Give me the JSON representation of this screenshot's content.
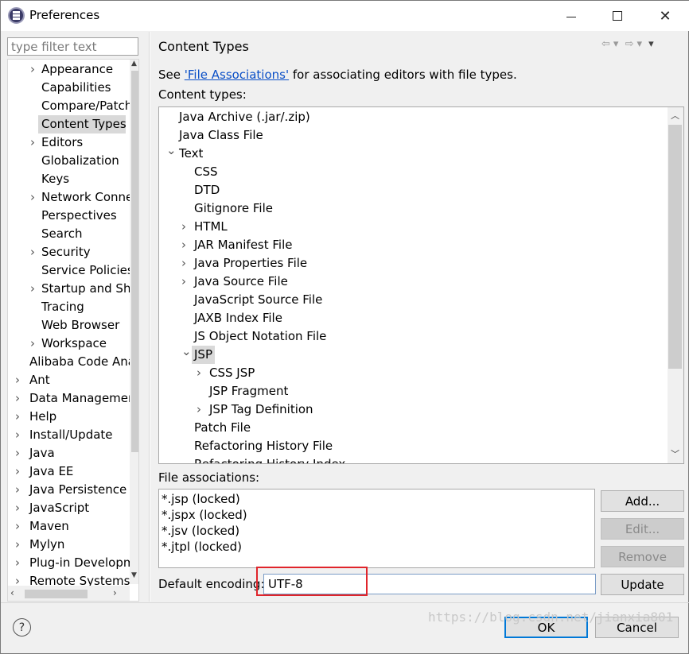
{
  "window": {
    "title": "Preferences",
    "icon": "eclipse-icon"
  },
  "filter": {
    "placeholder": "type filter text"
  },
  "left_tree": [
    {
      "label": "Appearance",
      "expandable": true
    },
    {
      "label": "Capabilities",
      "expandable": false
    },
    {
      "label": "Compare/Patch",
      "expandable": false
    },
    {
      "label": "Content Types",
      "expandable": false,
      "selected": true
    },
    {
      "label": "Editors",
      "expandable": true
    },
    {
      "label": "Globalization",
      "expandable": false
    },
    {
      "label": "Keys",
      "expandable": false
    },
    {
      "label": "Network Connections",
      "expandable": true
    },
    {
      "label": "Perspectives",
      "expandable": false
    },
    {
      "label": "Search",
      "expandable": false
    },
    {
      "label": "Security",
      "expandable": true
    },
    {
      "label": "Service Policies",
      "expandable": false
    },
    {
      "label": "Startup and Shutdown",
      "expandable": true
    },
    {
      "label": "Tracing",
      "expandable": false
    },
    {
      "label": "Web Browser",
      "expandable": false
    },
    {
      "label": "Workspace",
      "expandable": true
    },
    {
      "label": "Alibaba Code Analysis",
      "expandable": false,
      "level": 0
    },
    {
      "label": "Ant",
      "expandable": true,
      "level": 0
    },
    {
      "label": "Data Management",
      "expandable": true,
      "level": 0
    },
    {
      "label": "Help",
      "expandable": true,
      "level": 0
    },
    {
      "label": "Install/Update",
      "expandable": true,
      "level": 0
    },
    {
      "label": "Java",
      "expandable": true,
      "level": 0
    },
    {
      "label": "Java EE",
      "expandable": true,
      "level": 0
    },
    {
      "label": "Java Persistence",
      "expandable": true,
      "level": 0
    },
    {
      "label": "JavaScript",
      "expandable": true,
      "level": 0
    },
    {
      "label": "Maven",
      "expandable": true,
      "level": 0
    },
    {
      "label": "Mylyn",
      "expandable": true,
      "level": 0
    },
    {
      "label": "Plug-in Development",
      "expandable": true,
      "level": 0
    },
    {
      "label": "Remote Systems",
      "expandable": true,
      "level": 0
    }
  ],
  "panel": {
    "title": "Content Types",
    "see_prefix": "See ",
    "see_link": "'File Associations'",
    "see_suffix": " for associating editors with file types.",
    "content_types_label": "Content types:",
    "file_assoc_label": "File associations:",
    "encoding_label": "Default encoding:",
    "encoding_value": "UTF-8"
  },
  "content_tree": [
    {
      "label": "Java Archive (.jar/.zip)",
      "level": 0,
      "toggle": "none"
    },
    {
      "label": "Java Class File",
      "level": 0,
      "toggle": "none"
    },
    {
      "label": "Text",
      "level": 0,
      "toggle": "open"
    },
    {
      "label": "CSS",
      "level": 1,
      "toggle": "none"
    },
    {
      "label": "DTD",
      "level": 1,
      "toggle": "none"
    },
    {
      "label": "Gitignore File",
      "level": 1,
      "toggle": "none"
    },
    {
      "label": "HTML",
      "level": 1,
      "toggle": "closed"
    },
    {
      "label": "JAR Manifest File",
      "level": 1,
      "toggle": "closed"
    },
    {
      "label": "Java Properties File",
      "level": 1,
      "toggle": "closed"
    },
    {
      "label": "Java Source File",
      "level": 1,
      "toggle": "closed"
    },
    {
      "label": "JavaScript Source File",
      "level": 1,
      "toggle": "none"
    },
    {
      "label": "JAXB Index File",
      "level": 1,
      "toggle": "none"
    },
    {
      "label": "JS Object Notation File",
      "level": 1,
      "toggle": "none"
    },
    {
      "label": "JSP",
      "level": 1,
      "toggle": "open",
      "selected": true
    },
    {
      "label": "CSS JSP",
      "level": 2,
      "toggle": "closed"
    },
    {
      "label": "JSP Fragment",
      "level": 2,
      "toggle": "none"
    },
    {
      "label": "JSP Tag Definition",
      "level": 2,
      "toggle": "closed"
    },
    {
      "label": "Patch File",
      "level": 1,
      "toggle": "none"
    },
    {
      "label": "Refactoring History File",
      "level": 1,
      "toggle": "none"
    },
    {
      "label": "Refactoring History Index",
      "level": 1,
      "toggle": "none"
    }
  ],
  "file_associations": [
    "*.jsp (locked)",
    "*.jspx (locked)",
    "*.jsv (locked)",
    "*.jtpl (locked)"
  ],
  "buttons": {
    "add": "Add...",
    "edit": "Edit...",
    "remove": "Remove",
    "update": "Update",
    "ok": "OK",
    "cancel": "Cancel"
  },
  "watermark": "https://blog.csdn.net/jianxia801",
  "colors": {
    "link": "#0a4fc7",
    "highlight": "#e0252b",
    "selection": "#d9d9d9"
  }
}
